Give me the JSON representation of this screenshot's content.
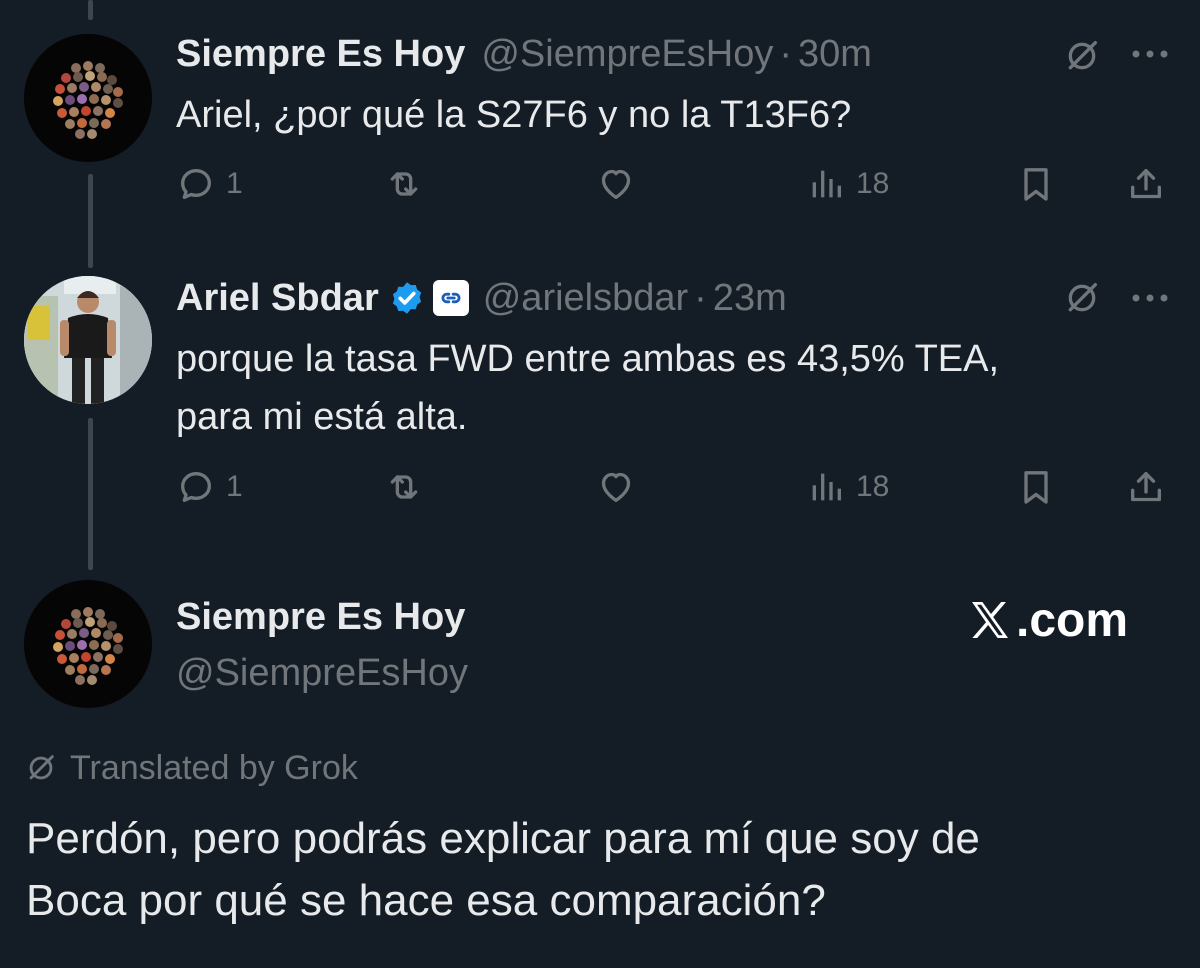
{
  "tweets": [
    {
      "display_name": "Siempre Es Hoy",
      "handle": "@SiempreEsHoy",
      "separator": "·",
      "time": "30m",
      "text": "Ariel, ¿por qué la S27F6 y no la T13F6?",
      "replies": "1",
      "views": "18"
    },
    {
      "display_name": "Ariel Sbdar",
      "handle": "@arielsbdar",
      "separator": "·",
      "time": "23m",
      "text_line1": "porque la tasa FWD entre ambas es 43,5% TEA,",
      "text_line2": "para mi está alta.",
      "replies": "1",
      "views": "18",
      "verified": true
    }
  ],
  "main_post": {
    "display_name": "Siempre Es Hoy",
    "handle": "@SiempreEsHoy",
    "translated_label": "Translated by Grok",
    "text_line1": "Perdón, pero podrás explicar para mí que soy de",
    "text_line2": "Boca por qué se hace esa comparación?"
  },
  "watermark": {
    "text": ".com"
  },
  "colors": {
    "background": "#141c26",
    "text_primary": "#e7e9ea",
    "text_secondary": "#71767b",
    "verified": "#1d9bf0",
    "thread_line": "#3b4650"
  },
  "icons": [
    "grok-icon",
    "more-icon",
    "reply-icon",
    "repost-icon",
    "like-icon",
    "views-icon",
    "bookmark-icon",
    "share-icon",
    "verified-icon",
    "link-icon",
    "x-logo-icon"
  ]
}
